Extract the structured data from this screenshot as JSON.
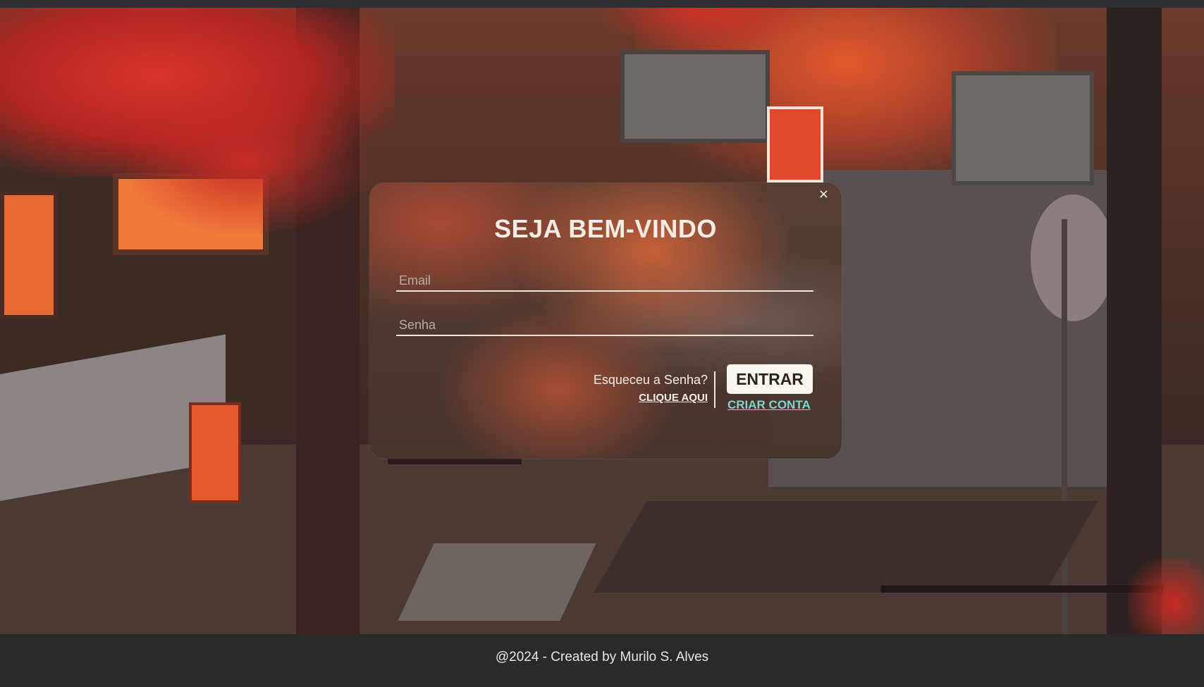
{
  "modal": {
    "close_label": "×",
    "title": "SEJA BEM-VINDO",
    "email_placeholder": "Email",
    "password_placeholder": "Senha",
    "forgot_question": "Esqueceu a Senha?",
    "forgot_link": "CLIQUE AQUI",
    "enter_button": "ENTRAR",
    "create_account_link": "CRIAR CONTA"
  },
  "footer": {
    "text": "@2024 - Created by Murilo S. Alves"
  },
  "colors": {
    "accent_link": "#7fd4cc",
    "button_bg": "#fbf6ef",
    "footer_bg": "#2a2a2d"
  },
  "icons": {
    "close": "close-icon"
  }
}
